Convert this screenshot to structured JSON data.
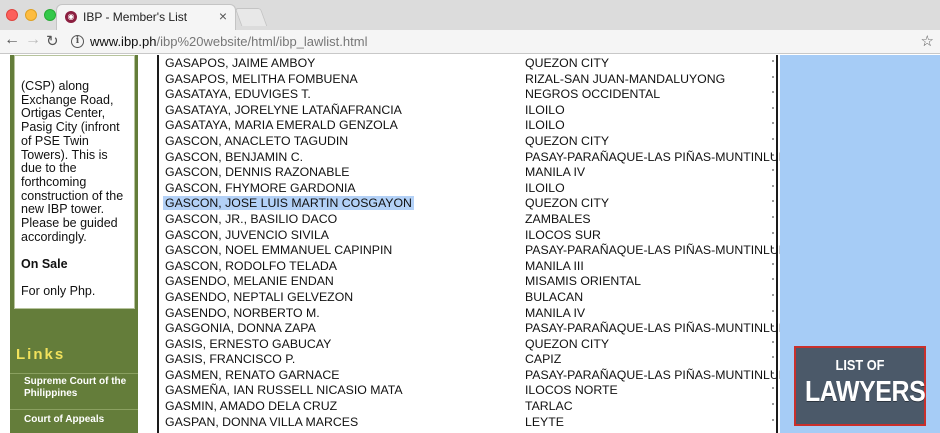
{
  "browser": {
    "tab_title": "IBP - Member's List",
    "favicon": "ibp-logo-icon",
    "url_host": "www.ibp.ph",
    "url_path": "/ibp%20website/html/ibp_lawlist.html"
  },
  "sidebar": {
    "notice_text": "(CSP) along Exchange Road, Ortigas Center, Pasig City (infront of PSE Twin Towers). This is due to the forthcoming construction of the new IBP tower. Please be guided accordingly.",
    "on_sale_label": "On Sale",
    "price_text": "For only Php.",
    "links_heading": "Links",
    "links": [
      {
        "label": "Supreme Court of the Philippines"
      },
      {
        "label": "Court of Appeals"
      }
    ]
  },
  "members": [
    {
      "name": "GASAPOS, JAIME AMBOY",
      "chapter": "QUEZON CITY"
    },
    {
      "name": "GASAPOS, MELITHA FOMBUENA",
      "chapter": "RIZAL-SAN JUAN-MANDALUYONG"
    },
    {
      "name": "GASATAYA, EDUVIGES T.",
      "chapter": "NEGROS OCCIDENTAL"
    },
    {
      "name": "GASATAYA, JORELYNE LATAÑAFRANCIA",
      "chapter": "ILOILO"
    },
    {
      "name": "GASATAYA, MARIA EMERALD GENZOLA",
      "chapter": "ILOILO"
    },
    {
      "name": "GASCON, ANACLETO TAGUDIN",
      "chapter": "QUEZON CITY"
    },
    {
      "name": "GASCON, BENJAMIN C.",
      "chapter": "PASAY-PARAÑAQUE-LAS PIÑAS-MUNTINLUPA"
    },
    {
      "name": "GASCON, DENNIS RAZONABLE",
      "chapter": "MANILA IV"
    },
    {
      "name": "GASCON, FHYMORE GARDONIA",
      "chapter": "ILOILO"
    },
    {
      "name": "GASCON, JOSE LUIS MARTIN COSGAYON",
      "chapter": "QUEZON CITY",
      "highlighted": true
    },
    {
      "name": "GASCON, JR., BASILIO DACO",
      "chapter": "ZAMBALES"
    },
    {
      "name": "GASCON, JUVENCIO SIVILA",
      "chapter": "ILOCOS SUR"
    },
    {
      "name": "GASCON, NOEL EMMANUEL CAPINPIN",
      "chapter": "PASAY-PARAÑAQUE-LAS PIÑAS-MUNTINLUPA"
    },
    {
      "name": "GASCON, RODOLFO TELADA",
      "chapter": "MANILA III"
    },
    {
      "name": "GASENDO, MELANIE ENDAN",
      "chapter": "MISAMIS ORIENTAL"
    },
    {
      "name": "GASENDO, NEPTALI GELVEZON",
      "chapter": "BULACAN"
    },
    {
      "name": "GASENDO, NORBERTO M.",
      "chapter": "MANILA IV"
    },
    {
      "name": "GASGONIA, DONNA ZAPA",
      "chapter": "PASAY-PARAÑAQUE-LAS PIÑAS-MUNTINLUPA"
    },
    {
      "name": "GASIS, ERNESTO GABUCAY",
      "chapter": "QUEZON CITY"
    },
    {
      "name": "GASIS, FRANCISCO P.",
      "chapter": "CAPIZ"
    },
    {
      "name": "GASMEN, RENATO GARNACE",
      "chapter": "PASAY-PARAÑAQUE-LAS PIÑAS-MUNTINLUPA"
    },
    {
      "name": "GASMEÑA, IAN RUSSELL NICASIO MATA",
      "chapter": "ILOCOS NORTE"
    },
    {
      "name": "GASMIN, AMADO DELA CRUZ",
      "chapter": "TARLAC"
    },
    {
      "name": "GASPAN, DONNA VILLA MARCES",
      "chapter": "LEYTE"
    }
  ],
  "banner": {
    "line1": "LIST OF",
    "line2": "LAWYERS"
  }
}
